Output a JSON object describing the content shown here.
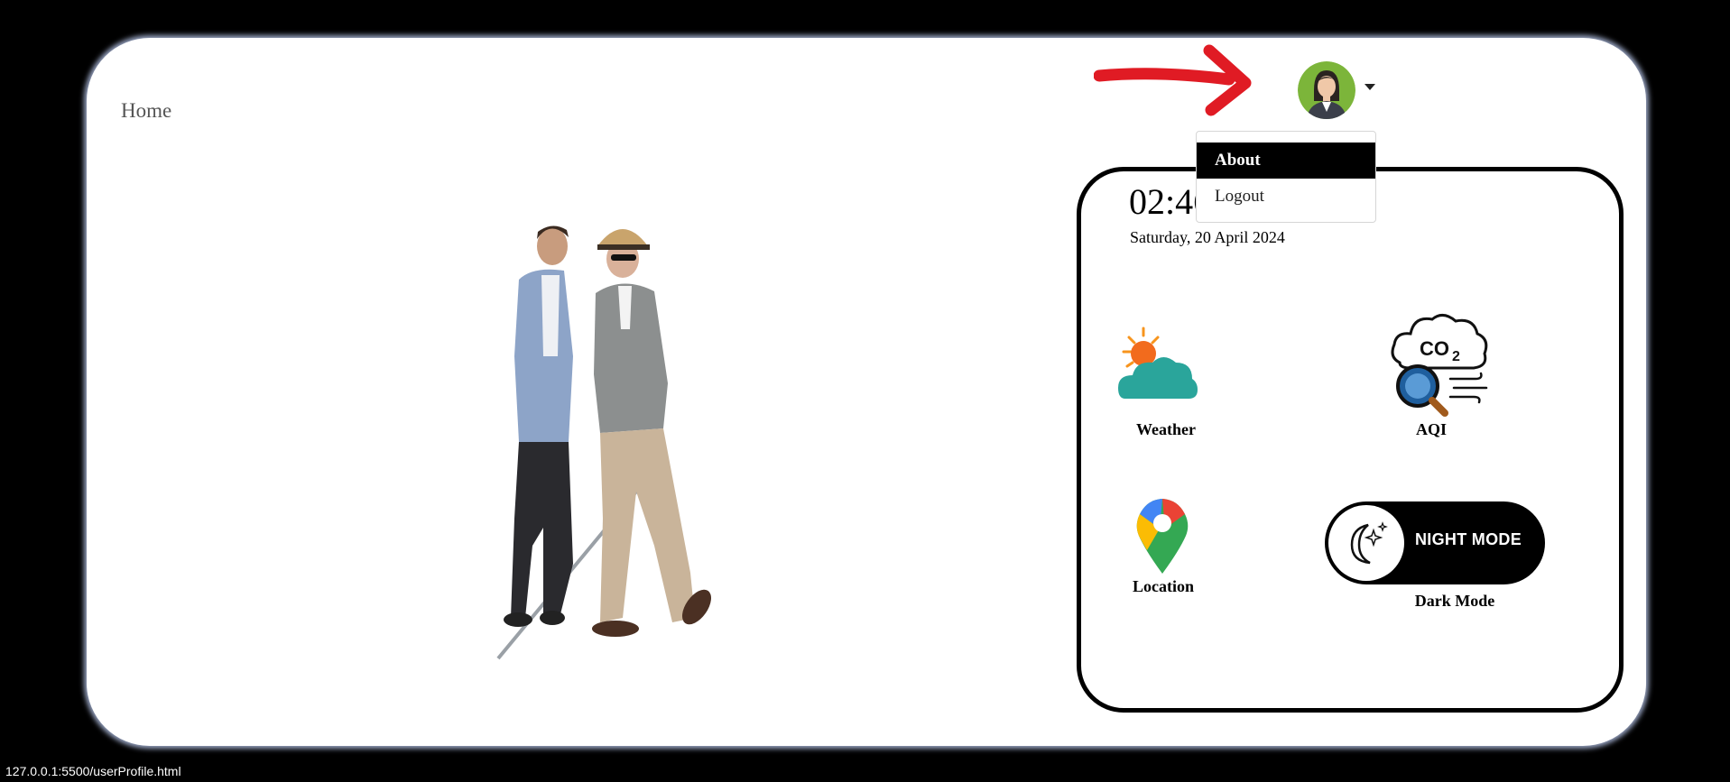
{
  "nav": {
    "home_label": "Home"
  },
  "profile": {
    "avatar_icon": "user-avatar-icon",
    "caret_icon": "caret-down-icon"
  },
  "dropdown": {
    "items": [
      {
        "label": "About"
      },
      {
        "label": "Logout"
      }
    ]
  },
  "clock": {
    "time": "02:46",
    "date": "Saturday, 20 April 2024"
  },
  "tiles": {
    "weather": {
      "label": "Weather",
      "icon": "weather-icon"
    },
    "aqi": {
      "label": "AQI",
      "icon": "co2-aqi-icon"
    },
    "location": {
      "label": "Location",
      "icon": "map-pin-icon"
    },
    "dark_mode": {
      "label": "Dark Mode",
      "toggle_text": "NIGHT MODE",
      "icon": "moon-icon"
    }
  },
  "status_bar": {
    "url": "127.0.0.1:5500/userProfile.html"
  },
  "colors": {
    "annotation_arrow": "#e01b24",
    "panel_border": "#000000",
    "menu_active": "#000000"
  }
}
